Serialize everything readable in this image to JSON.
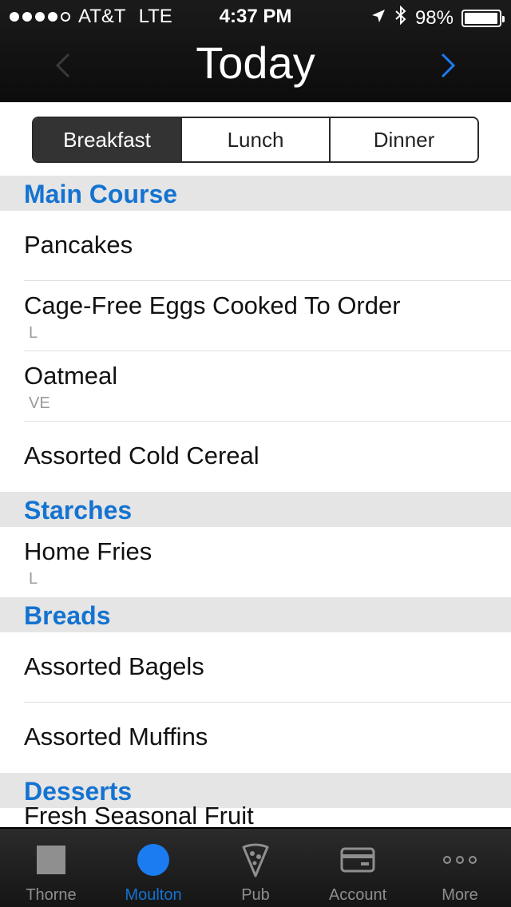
{
  "status": {
    "carrier": "AT&T",
    "network": "LTE",
    "time": "4:37 PM",
    "battery_percent": "98%",
    "battery_level": 0.98,
    "signal_bars_filled": 4,
    "signal_bars_total": 5
  },
  "nav": {
    "title": "Today",
    "prev_icon": "chevron-left-icon",
    "next_icon": "chevron-right-icon"
  },
  "segments": {
    "options": [
      "Breakfast",
      "Lunch",
      "Dinner"
    ],
    "selected": "Breakfast"
  },
  "sections": [
    {
      "title": "Main Course",
      "items": [
        {
          "name": "Pancakes",
          "tag": ""
        },
        {
          "name": "Cage-Free Eggs Cooked To Order",
          "tag": "L"
        },
        {
          "name": "Oatmeal",
          "tag": "VE"
        },
        {
          "name": "Assorted Cold Cereal",
          "tag": ""
        }
      ]
    },
    {
      "title": "Starches",
      "items": [
        {
          "name": "Home Fries",
          "tag": "L"
        }
      ]
    },
    {
      "title": "Breads",
      "items": [
        {
          "name": "Assorted Bagels",
          "tag": ""
        },
        {
          "name": "Assorted Muffins",
          "tag": ""
        }
      ]
    },
    {
      "title": "Desserts",
      "items": [
        {
          "name": "Fresh Seasonal Fruit",
          "tag": ""
        }
      ]
    }
  ],
  "tabs": [
    {
      "label": "Thorne",
      "icon": "square-icon",
      "active": false
    },
    {
      "label": "Moulton",
      "icon": "circle-icon",
      "active": true
    },
    {
      "label": "Pub",
      "icon": "pizza-icon",
      "active": false
    },
    {
      "label": "Account",
      "icon": "card-icon",
      "active": false
    },
    {
      "label": "More",
      "icon": "more-icon",
      "active": false
    }
  ],
  "colors": {
    "accent": "#1473d1",
    "bar": "#111111",
    "section_bg": "#e5e5e5"
  }
}
